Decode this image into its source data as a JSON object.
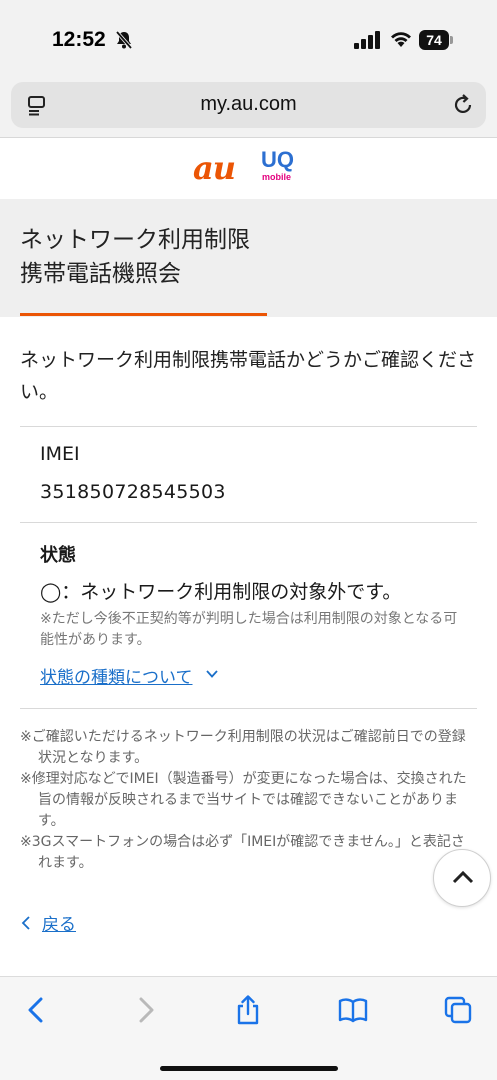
{
  "status_bar": {
    "time": "12:52",
    "battery": "74",
    "icons": [
      "bell-slash-icon",
      "signal-icon",
      "wifi-icon",
      "battery-icon"
    ]
  },
  "browser": {
    "url": "my.au.com",
    "icons": [
      "reader-menu-icon",
      "reload-icon"
    ]
  },
  "brand": {
    "au": "au",
    "uq": "UQ",
    "uq_sub": "mobile",
    "au_color": "#eb5505",
    "uq_color": "#2c6fd1",
    "mobile_color": "#e4007f"
  },
  "page": {
    "title_line1": "ネットワーク利用制限",
    "title_line2": "携帯電話機照会",
    "intro": "ネットワーク利用制限携帯電話かどうかご確認ください。"
  },
  "result": {
    "imei_label": "IMEI",
    "imei_value": "351850728545503",
    "status_label": "状態",
    "status_text": "◯：ネットワーク利用制限の対象外です。",
    "status_note": "※ただし今後不正契約等が判明した場合は利用制限の対象となる可能性があります。",
    "status_link": "状態の種類について"
  },
  "notes": [
    "※ご確認いただけるネットワーク利用制限の状況はご確認前日での登録状況となります。",
    "※修理対応などでIMEI（製造番号）が変更になった場合は、交換された旨の情報が反映されるまで当サイトでは確認できないことがあります。",
    "※3Gスマートフォンの場合は必ず「IMEIが確認できません。」と表記されます。"
  ],
  "nav": {
    "back_label": "戻る"
  },
  "toolbar": {
    "icons": [
      "back-arrow-icon",
      "forward-arrow-icon",
      "share-icon",
      "bookmarks-icon",
      "tabs-icon"
    ]
  },
  "colors": {
    "accent": "#eb5505",
    "link": "#1a6fc9",
    "ios_blue": "#1a73e8"
  }
}
